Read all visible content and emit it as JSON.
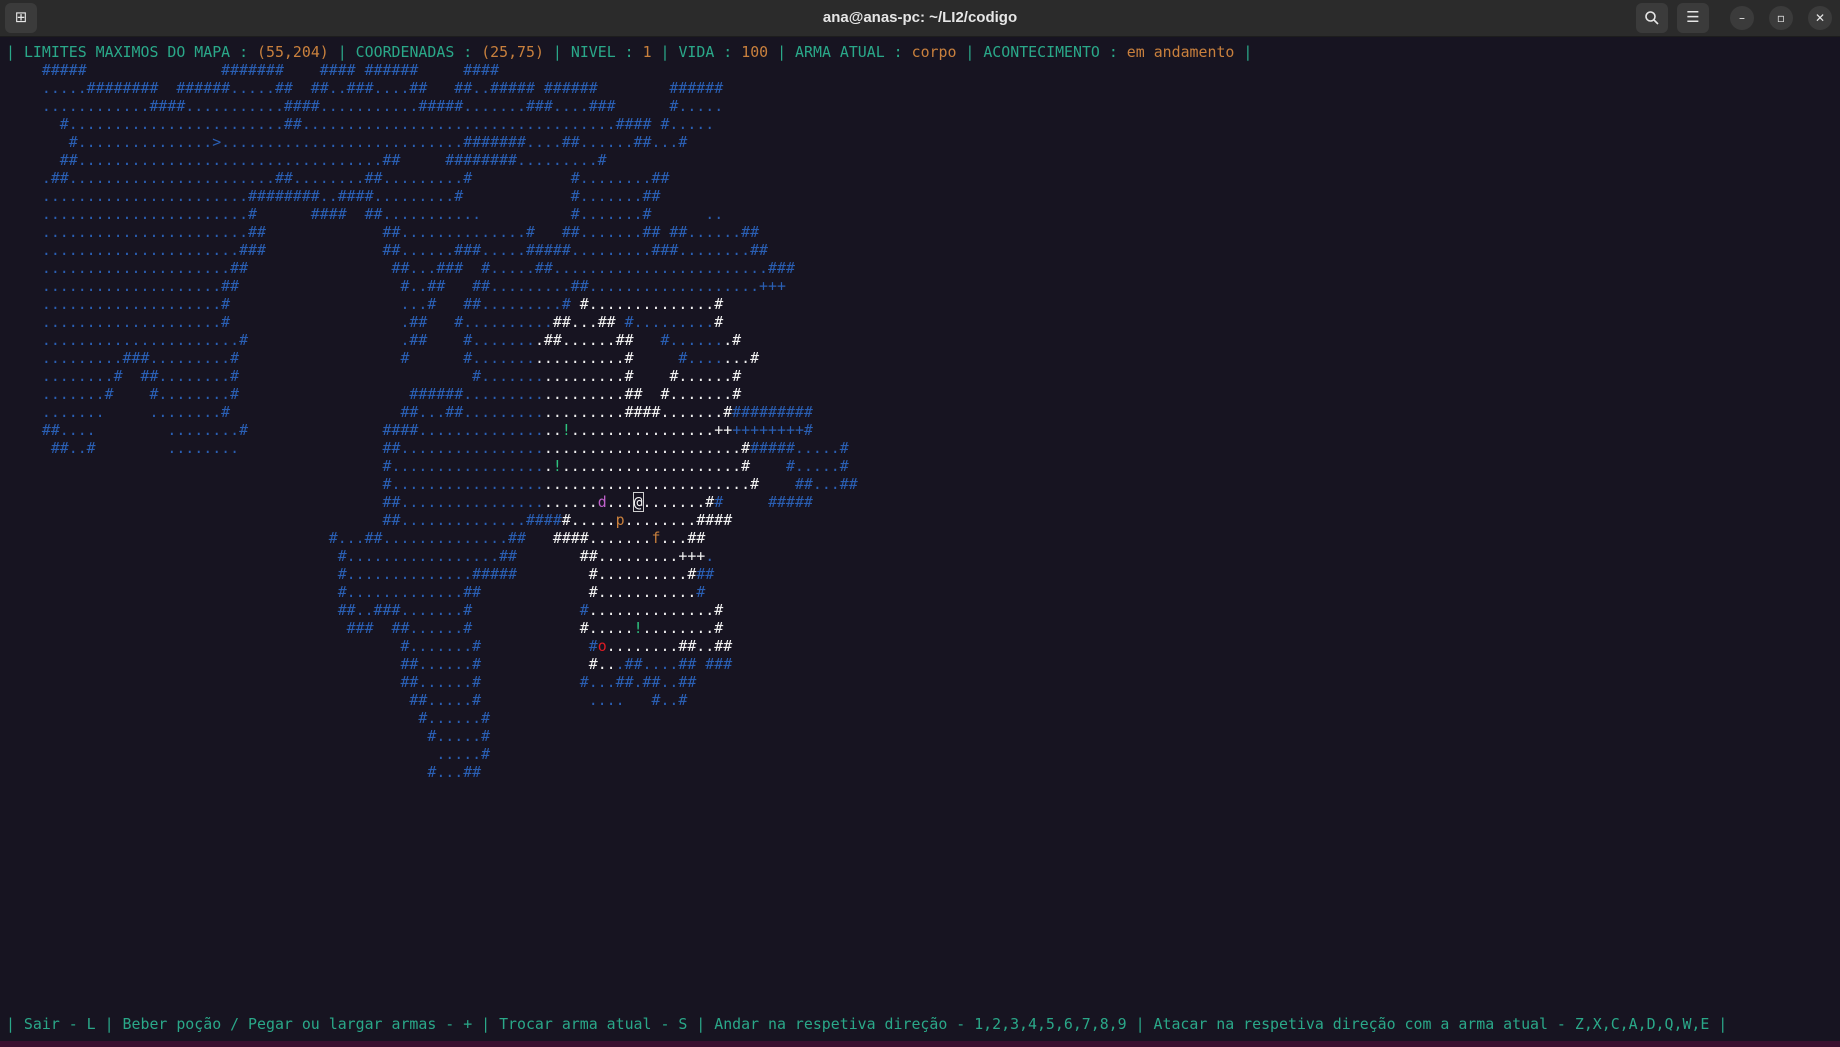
{
  "window": {
    "title": "ana@anas-pc: ~/LI2/codigo",
    "icons": {
      "new_tab": "new-tab-icon",
      "search": "search-icon",
      "menu": "hamburger-menu-icon",
      "minimize": "minimize-icon",
      "maximize": "maximize-icon",
      "close": "close-icon"
    }
  },
  "status": {
    "sep": "|",
    "limits_label": "LIMITES MAXIMOS DO MAPA :",
    "limits_value": "(55,204)",
    "coords_label": "COORDENADAS :",
    "coords_value": "(25,75)",
    "level_label": "NIVEL :",
    "level_value": "1",
    "life_label": "VIDA :",
    "life_value": "100",
    "weapon_label": "ARMA ATUAL :",
    "weapon_value": "corpo",
    "event_label": "ACONTECIMENTO :",
    "event_value": "em andamento"
  },
  "map": {
    "entities": {
      "player": "@",
      "enemy_d": "d",
      "enemy_p": "p",
      "enemy_f": "f",
      "enemy_o": "o",
      "potion": "!",
      "exit": ">"
    },
    "colors": {
      "background": "#171421",
      "wall_remembered": "#2a5fb4",
      "visible": "#f2f2f2",
      "potion": "#2ec27e",
      "enemy_d": "#c061cb",
      "enemy_p": "#c9803d",
      "enemy_o": "#e01b24",
      "status_text": "#2aa889",
      "status_value": "#c9803d"
    }
  },
  "help": {
    "text": "| Sair - L | Beber poção / Pegar ou largar armas - + | Trocar arma atual - S | Andar na respetiva direção - 1,2,3,4,5,6,7,8,9 | Atacar na respetiva direção com a arma atual - Z,X,C,A,D,Q,W,E |"
  }
}
